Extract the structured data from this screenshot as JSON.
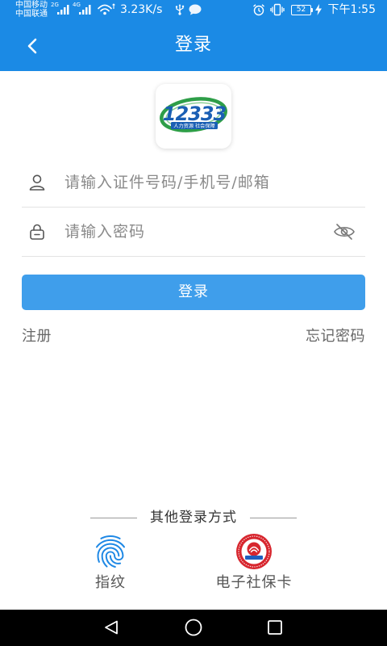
{
  "status_bar": {
    "carriers": [
      "中国移动",
      "中国联通"
    ],
    "sim1_network": "2G",
    "sim2_network": "4G",
    "net_speed": "3.23K/s",
    "battery_level": "52",
    "time": "下午1:55",
    "icons": [
      "signal-icon",
      "signal-icon",
      "wifi-icon",
      "usb-icon",
      "message-icon",
      "alarm-icon",
      "vibrate-icon",
      "battery-icon",
      "charging-icon"
    ]
  },
  "header": {
    "back_icon": "chevron-left-icon",
    "title": "登录"
  },
  "logo": {
    "number": "12333",
    "tagline": "人力资源 社会保障"
  },
  "login_form": {
    "account_field": {
      "icon": "user-icon",
      "placeholder": "请输入证件号码/手机号/邮箱",
      "value": ""
    },
    "password_field": {
      "icon": "lock-icon",
      "placeholder": "请输入密码",
      "value": "",
      "visibility_icon": "eye-off-icon"
    },
    "submit_label": "登录"
  },
  "links": {
    "register": "注册",
    "forgot_password": "忘记密码"
  },
  "other_login": {
    "heading": "其他登录方式",
    "options": [
      {
        "label": "指纹",
        "icon": "fingerprint-icon"
      },
      {
        "label": "电子社保卡",
        "icon": "social-security-card-icon"
      }
    ]
  },
  "nav_bar": {
    "icons": [
      "back-triangle-icon",
      "home-circle-icon",
      "recent-apps-icon"
    ]
  },
  "colors": {
    "primary": "#1B8AE5",
    "button": "#3F9EEB",
    "text": "#333333",
    "placeholder": "#8A8A8A",
    "link": "#666666",
    "logo_green": "#2E9E48",
    "logo_blue": "#1A5FB4",
    "card_red": "#D7262E",
    "fingerprint": "#1E88E5"
  }
}
